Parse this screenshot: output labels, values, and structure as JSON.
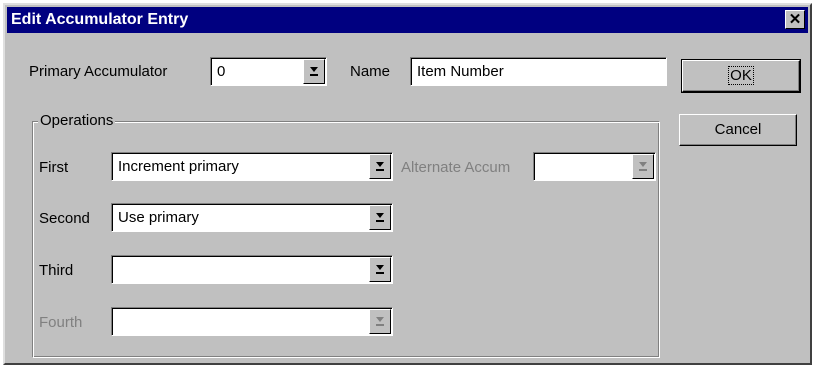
{
  "dialog": {
    "title": "Edit Accumulator Entry",
    "close_glyph": "✕"
  },
  "primary_accumulator": {
    "label": "Primary Accumulator",
    "value": "0"
  },
  "name": {
    "label": "Name",
    "value": "Item Number"
  },
  "buttons": {
    "ok": "OK",
    "cancel": "Cancel"
  },
  "operations": {
    "legend": "Operations",
    "first": {
      "label": "First",
      "value": "Increment primary"
    },
    "second": {
      "label": "Second",
      "value": "Use primary"
    },
    "third": {
      "label": "Third",
      "value": ""
    },
    "fourth": {
      "label": "Fourth",
      "value": ""
    },
    "alternate": {
      "label": "Alternate Accum",
      "value": ""
    }
  },
  "icons": {
    "dropdown": "dropdown-arrow-icon",
    "dropdown_disabled": "dropdown-arrow-disabled-icon",
    "close": "close-icon"
  },
  "colors": {
    "titlebar": "#000080",
    "face": "#c0c0c0",
    "disabled_text": "#808080"
  }
}
